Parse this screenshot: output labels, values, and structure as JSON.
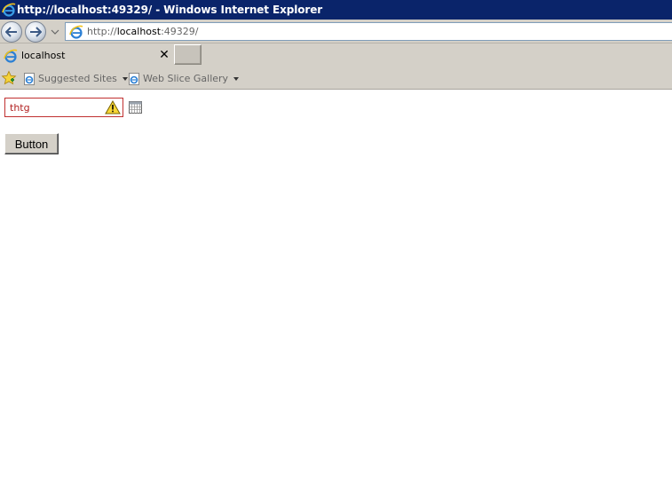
{
  "window": {
    "title": "http://localhost:49329/ - Windows Internet Explorer"
  },
  "address_bar": {
    "prefix": "http://",
    "host": "localhost",
    "suffix": ":49329/"
  },
  "tab": {
    "label": "localhost",
    "close_glyph": "✕"
  },
  "favorites": {
    "items": [
      {
        "label": "Suggested Sites"
      },
      {
        "label": "Web Slice Gallery"
      }
    ]
  },
  "form": {
    "input_value": "thtg",
    "button_label": "Button"
  },
  "colors": {
    "titlebar": "#0a246a",
    "chrome": "#d4d0c8",
    "error_border": "#c03030",
    "error_text": "#b22222"
  },
  "icons": {
    "browser": "ie-icon",
    "favorites": "favorites-star-icon",
    "validation": "warning-icon",
    "picker": "calendar-icon"
  }
}
